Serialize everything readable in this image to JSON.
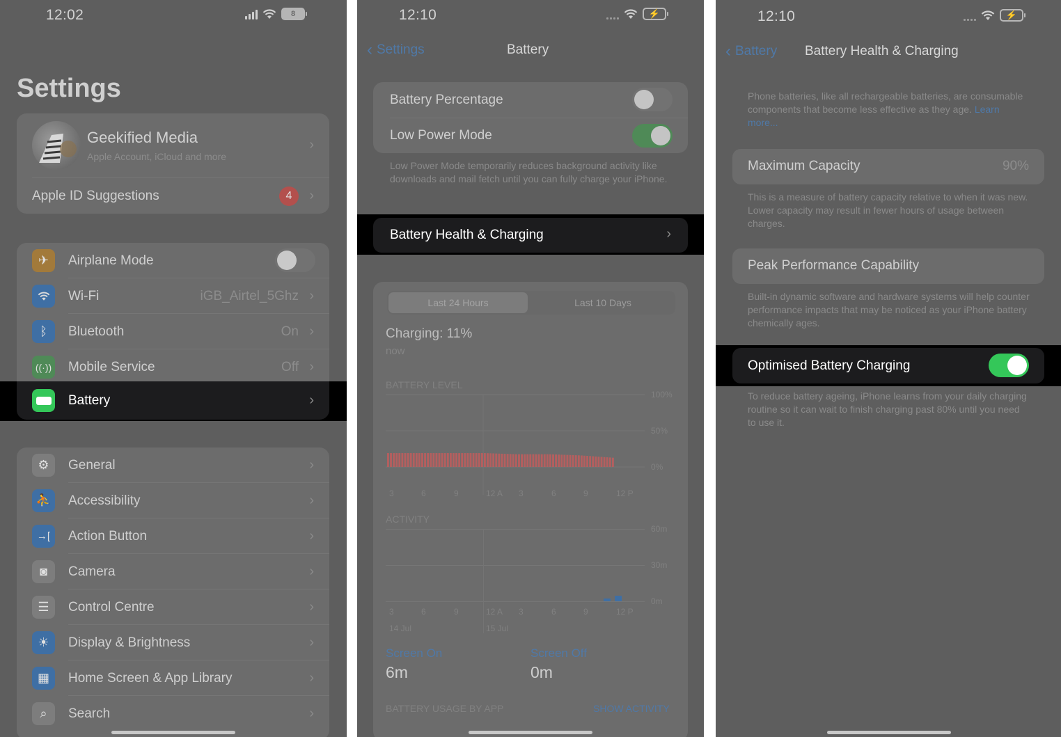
{
  "phone1": {
    "time": "12:02",
    "battery_number": "8",
    "title": "Settings",
    "profile": {
      "name": "Geekified Media",
      "subtitle": "Apple Account, iCloud and more"
    },
    "suggestions": {
      "label": "Apple ID Suggestions",
      "badge": "4"
    },
    "connectivity": [
      {
        "label": "Airplane Mode",
        "value": "",
        "icon": "airplane-icon",
        "color": "#a27a3b"
      },
      {
        "label": "Wi-Fi",
        "value": "iGB_Airtel_5Ghz",
        "icon": "wifi-icon",
        "color": "#3f6fa4"
      },
      {
        "label": "Bluetooth",
        "value": "On",
        "icon": "bluetooth-icon",
        "color": "#3f6fa4"
      },
      {
        "label": "Mobile Service",
        "value": "Off",
        "icon": "antenna-icon",
        "color": "#4f8a57"
      },
      {
        "label": "Battery",
        "value": "",
        "icon": "battery-icon",
        "color": "#34c759"
      }
    ],
    "general": [
      {
        "label": "General",
        "icon": "gear-icon"
      },
      {
        "label": "Accessibility",
        "icon": "accessibility-icon"
      },
      {
        "label": "Action Button",
        "icon": "action-button-icon"
      },
      {
        "label": "Camera",
        "icon": "camera-icon"
      },
      {
        "label": "Control Centre",
        "icon": "control-centre-icon"
      },
      {
        "label": "Display & Brightness",
        "icon": "sun-icon"
      },
      {
        "label": "Home Screen & App Library",
        "icon": "home-screen-icon"
      },
      {
        "label": "Search",
        "icon": "search-icon"
      }
    ]
  },
  "phone2": {
    "time": "12:10",
    "back": "Settings",
    "title": "Battery",
    "battery_percentage": "Battery Percentage",
    "low_power": "Low Power Mode",
    "low_power_note": "Low Power Mode temporarily reduces background activity like downloads and mail fetch until you can fully charge your iPhone.",
    "health_row": "Battery Health & Charging",
    "seg_24h": "Last 24 Hours",
    "seg_10d": "Last 10 Days",
    "charging": "Charging: 11%",
    "charging_time": "now",
    "battery_level_label": "BATTERY LEVEL",
    "level_ticks": [
      "100%",
      "50%",
      "0%"
    ],
    "x_ticks": [
      "3",
      "6",
      "9",
      "12 A",
      "3",
      "6",
      "9",
      "12 P"
    ],
    "activity_label": "ACTIVITY",
    "activity_ticks": [
      "60m",
      "30m",
      "0m"
    ],
    "date_1": "14 Jul",
    "date_2": "15 Jul",
    "screen_on_label": "Screen On",
    "screen_on_value": "6m",
    "screen_off_label": "Screen Off",
    "screen_off_value": "0m",
    "usage_label": "BATTERY USAGE BY APP",
    "show_activity": "SHOW ACTIVITY"
  },
  "phone3": {
    "time": "12:10",
    "back": "Battery",
    "title": "Battery Health & Charging",
    "intro": "Phone batteries, like all rechargeable batteries, are consumable components that become less effective as they age.",
    "learn_more": "Learn more...",
    "max_capacity_label": "Maximum Capacity",
    "max_capacity_value": "90%",
    "max_capacity_note": "This is a measure of battery capacity relative to when it was new. Lower capacity may result in fewer hours of usage between charges.",
    "peak_label": "Peak Performance Capability",
    "peak_note": "Built-in dynamic software and hardware systems will help counter performance impacts that may be noticed as your iPhone battery chemically ages.",
    "optimised_label": "Optimised Battery Charging",
    "optimised_note": "To reduce battery ageing, iPhone learns from your daily charging routine so it can wait to finish charging past 80% until you need to use it."
  },
  "chart_data": {
    "type": "bar",
    "title": "BATTERY LEVEL",
    "categories": [
      "3",
      "6",
      "9",
      "12 A",
      "3",
      "6",
      "9",
      "12 P"
    ],
    "values": [
      12,
      12,
      12,
      12,
      11,
      11,
      10,
      8
    ],
    "ylim": [
      0,
      100
    ],
    "yticks": [
      "100%",
      "50%",
      "0%"
    ],
    "color": "#b45f5f"
  }
}
